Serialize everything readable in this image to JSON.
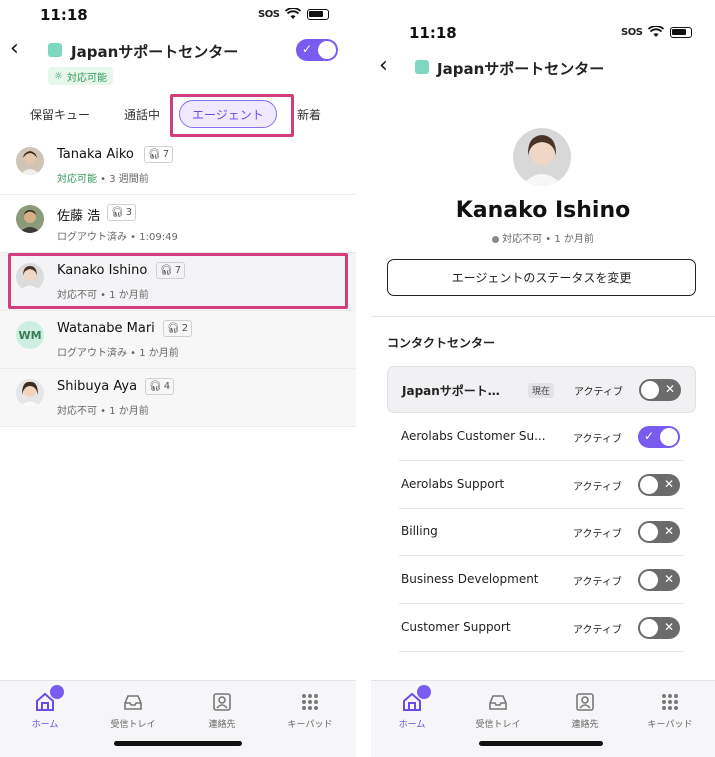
{
  "left": {
    "status_time": "11:18",
    "sos": "SOS",
    "header_title": "Japanサポートセンター",
    "availability_badge": "対応可能",
    "tabs": [
      "保留キュー",
      "通話中",
      "エージェント",
      "新着"
    ],
    "agents": [
      {
        "name": "Tanaka Aiko",
        "count": "7",
        "status": "対応可能",
        "time": "3 週間前"
      },
      {
        "name": "佐藤 浩",
        "count": "3",
        "status": "ログアウト済み",
        "time": "1:09:49"
      },
      {
        "name": "Kanako Ishino",
        "count": "7",
        "status": "対応不可",
        "time": "1 か月前"
      },
      {
        "name": "Watanabe Mari",
        "initials": "WM",
        "count": "2",
        "status": "ログアウト済み",
        "time": "1 か月前"
      },
      {
        "name": "Shibuya Aya",
        "count": "4",
        "status": "対応不可",
        "time": "1 か月前"
      }
    ]
  },
  "right": {
    "status_time": "11:18",
    "sos": "SOS",
    "header_title": "Japanサポートセンター",
    "profile_name": "Kanako Ishino",
    "profile_status": "対応不可",
    "profile_time": "1 か月前",
    "change_status_button": "エージェントのステータスを変更",
    "section_title": "コンタクトセンター",
    "current_label": "現在",
    "contact_centers": [
      {
        "name": "Japanサポート…",
        "current": true,
        "state": "アクティブ",
        "on": false
      },
      {
        "name": "Aerolabs Customer Su...",
        "current": false,
        "state": "アクティブ",
        "on": true
      },
      {
        "name": "Aerolabs Support",
        "current": false,
        "state": "アクティブ",
        "on": false
      },
      {
        "name": "Billing",
        "current": false,
        "state": "アクティブ",
        "on": false
      },
      {
        "name": "Business Development",
        "current": false,
        "state": "アクティブ",
        "on": false
      },
      {
        "name": "Customer Support",
        "current": false,
        "state": "アクティブ",
        "on": false
      }
    ]
  },
  "nav": [
    "ホーム",
    "受信トレイ",
    "連絡先",
    "キーパッド"
  ],
  "colors": {
    "accent": "#7a5bf0",
    "highlight": "#d23d7d",
    "available": "#2f9b58",
    "teal_square": "#7ed7c1"
  }
}
